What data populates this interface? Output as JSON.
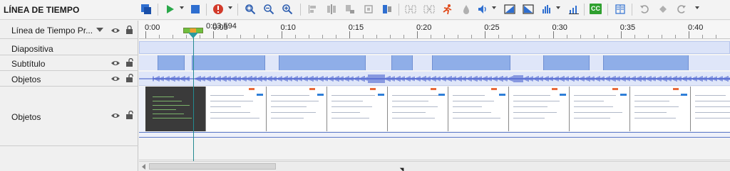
{
  "panel": {
    "title": "LÍNEA DE TIEMPO"
  },
  "toolbar": {
    "icons": [
      "layout-icon",
      "play-icon",
      "stop-icon",
      "record-icon",
      "zoom-fit-icon",
      "zoom-out-icon",
      "zoom-in-icon",
      "align-icon",
      "distribute-icon",
      "split-icon",
      "crop-icon",
      "paste-icon",
      "transition-icon",
      "motion-icon",
      "fill-icon",
      "volume-icon",
      "fade-in-icon",
      "fade-out-icon",
      "audio-levels-icon",
      "closed-caption-icon",
      "columns-icon",
      "undo-icon",
      "marker-icon",
      "redo-icon"
    ],
    "cc_label": "CC",
    "colors": {
      "accent_blue": "#2f6fd0",
      "play_green": "#2aa84a",
      "record_red": "#d23a2a",
      "cc_green": "#2fa02f"
    }
  },
  "tracks": [
    {
      "label": "Línea de Tiempo Pr...",
      "has_dropdown": true,
      "visible": true,
      "locked": true
    },
    {
      "label": "Diapositiva"
    },
    {
      "label": "Subtítulo",
      "visible": true,
      "locked": false
    },
    {
      "label": "Objetos",
      "visible": true,
      "locked": false
    },
    {
      "label": "Objetos",
      "visible": true,
      "locked": false
    }
  ],
  "ruler": {
    "current_time": "0:03,594",
    "ticks": [
      "0:00",
      "0:05",
      "0:10",
      "0:15",
      "0:20",
      "0:25",
      "0:30",
      "0:35",
      "0:40"
    ]
  },
  "timeline": {
    "subtitle_gaps_seconds": [
      [
        0.0,
        0.9
      ],
      [
        2.9,
        3.4
      ],
      [
        8.8,
        9.8
      ],
      [
        16.2,
        18.1
      ],
      [
        19.7,
        21.1
      ],
      [
        26.9,
        29.3
      ],
      [
        32.7,
        33.7
      ],
      [
        40.0,
        41.5
      ]
    ],
    "thumbnail_count": 10
  }
}
